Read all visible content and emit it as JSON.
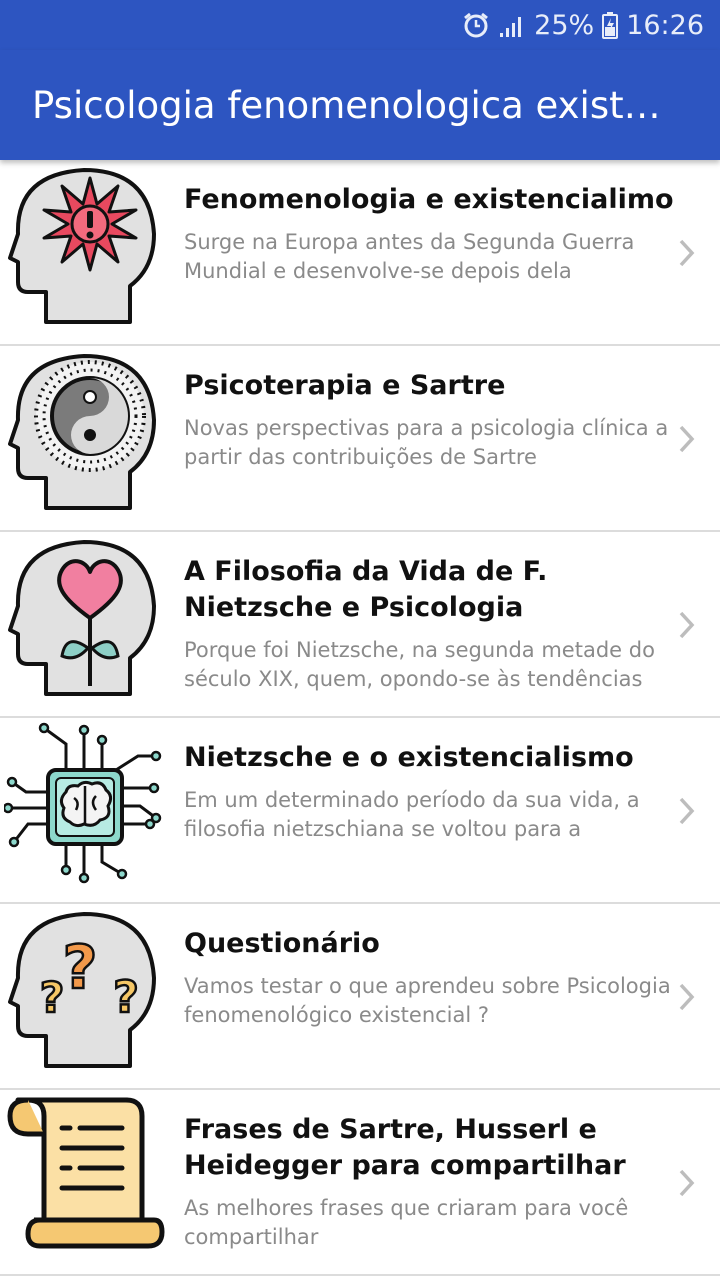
{
  "status_bar": {
    "battery_percent": "25%",
    "time": "16:26",
    "icons": [
      "alarm-icon",
      "signal-icon",
      "battery-icon"
    ]
  },
  "app_bar": {
    "title": "Psicologia fenomenologica existencial"
  },
  "items": [
    {
      "title": "Fenomenologia e existencialimo",
      "subtitle": "Surge na Europa antes da Segunda Guerra Mundial e desenvolve-se depois dela",
      "icon": "head-burst-icon"
    },
    {
      "title": "Psicoterapia e Sartre",
      "subtitle": "Novas perspectivas para a psicologia clínica a partir das contribuições de Sartre",
      "icon": "head-yin-yang-icon"
    },
    {
      "title": "A Filosofia da Vida de F. Nietzsche e Psicologia",
      "subtitle": "Porque foi Nietzsche, na segunda metade do século XIX, quem, opondo-se às tendências",
      "icon": "head-heart-icon"
    },
    {
      "title": "Nietzsche e o existencialismo",
      "subtitle": "Em um determinado período da sua vida, a filosofia nietzschiana se voltou para a",
      "icon": "brain-chip-icon"
    },
    {
      "title": "Questionário",
      "subtitle": "Vamos testar o que aprendeu sobre Psicologia fenomenológico existencial ?",
      "icon": "head-question-icon"
    },
    {
      "title": "Frases de Sartre, Husserl e Heidegger para compartilhar",
      "subtitle": "As melhores frases que criaram para você compartilhar",
      "icon": "scroll-icon"
    }
  ],
  "colors": {
    "primary": "#2d55c1",
    "title_text": "#111111",
    "subtitle_text": "#8a8a8a",
    "divider": "#dcdcdc"
  }
}
